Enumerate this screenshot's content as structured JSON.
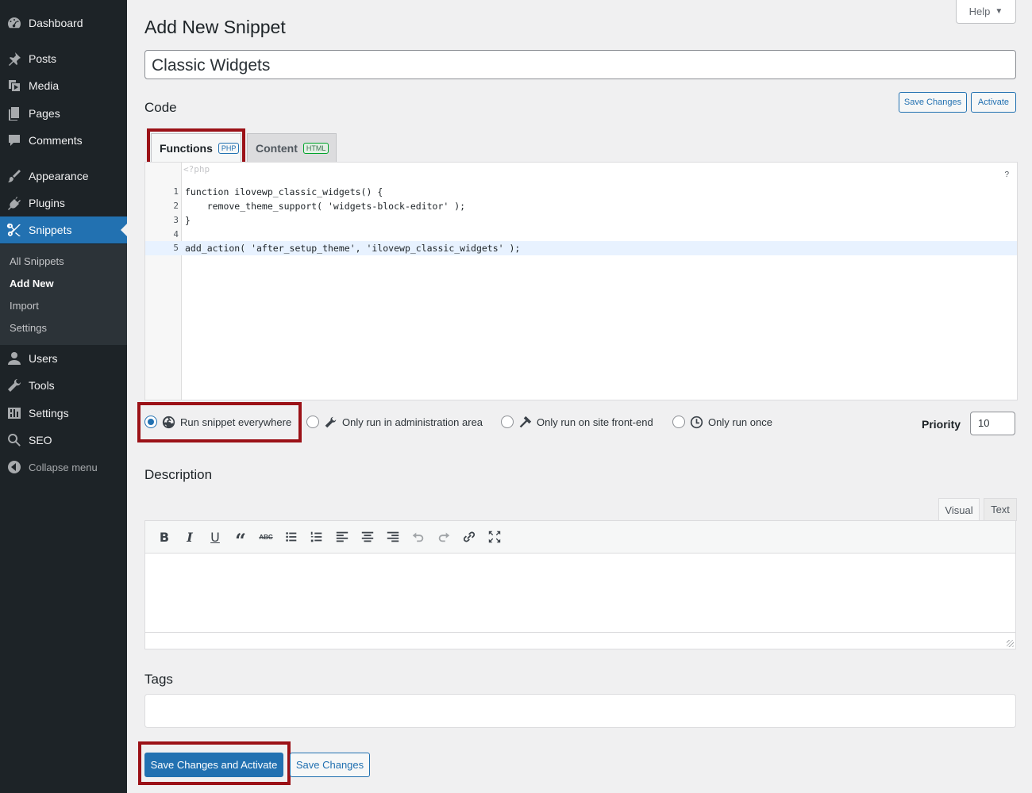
{
  "sidebar": {
    "items": [
      {
        "label": "Dashboard",
        "icon": "dashboard-icon"
      },
      {
        "label": "Posts",
        "icon": "pin-icon"
      },
      {
        "label": "Media",
        "icon": "media-icon"
      },
      {
        "label": "Pages",
        "icon": "pages-icon"
      },
      {
        "label": "Comments",
        "icon": "comment-icon"
      },
      {
        "label": "Appearance",
        "icon": "brush-icon"
      },
      {
        "label": "Plugins",
        "icon": "plugin-icon"
      },
      {
        "label": "Snippets",
        "icon": "scissors-icon"
      },
      {
        "label": "Users",
        "icon": "user-icon"
      },
      {
        "label": "Tools",
        "icon": "wrench-icon"
      },
      {
        "label": "Settings",
        "icon": "settings-icon"
      },
      {
        "label": "SEO",
        "icon": "search-icon"
      }
    ],
    "submenu": [
      "All Snippets",
      "Add New",
      "Import",
      "Settings"
    ],
    "collapse_label": "Collapse menu"
  },
  "header": {
    "help_label": "Help",
    "page_title": "Add New Snippet"
  },
  "snippet": {
    "title_value": "Classic Widgets",
    "code_label": "Code",
    "save_changes_small": "Save Changes",
    "activate_small": "Activate",
    "tabs": [
      {
        "label": "Functions",
        "badge": "PHP"
      },
      {
        "label": "Content",
        "badge": "HTML"
      }
    ],
    "php_open_tag": "<?php",
    "help_mark": "?",
    "code_lines": [
      {
        "n": "1",
        "text": "function ilovewp_classic_widgets() {"
      },
      {
        "n": "2",
        "text": "    remove_theme_support( 'widgets-block-editor' );"
      },
      {
        "n": "3",
        "text": "}"
      },
      {
        "n": "4",
        "text": ""
      },
      {
        "n": "5",
        "text": "add_action( 'after_setup_theme', 'ilovewp_classic_widgets' );"
      }
    ]
  },
  "scope": {
    "options": [
      {
        "label": "Run snippet everywhere",
        "icon": "globe-icon",
        "checked": true
      },
      {
        "label": "Only run in administration area",
        "icon": "wrench-icon",
        "checked": false
      },
      {
        "label": "Only run on site front-end",
        "icon": "hammer-icon",
        "checked": false
      },
      {
        "label": "Only run once",
        "icon": "clock-icon",
        "checked": false
      }
    ],
    "priority_label": "Priority",
    "priority_value": "10"
  },
  "description": {
    "label": "Description",
    "tab_visual": "Visual",
    "tab_text": "Text",
    "toolbar": [
      "bold-icon",
      "italic-icon",
      "underline-icon",
      "blockquote-icon",
      "strikethrough-icon",
      "bullet-list-icon",
      "numbered-list-icon",
      "align-left-icon",
      "align-center-icon",
      "align-right-icon",
      "undo-icon",
      "redo-icon",
      "link-icon",
      "fullscreen-icon"
    ]
  },
  "tags": {
    "label": "Tags"
  },
  "footer": {
    "save_activate_label": "Save Changes and Activate",
    "save_label": "Save Changes"
  },
  "colors": {
    "accent": "#2271b1",
    "highlight": "#9b1117",
    "sidebar_bg": "#1d2327"
  }
}
